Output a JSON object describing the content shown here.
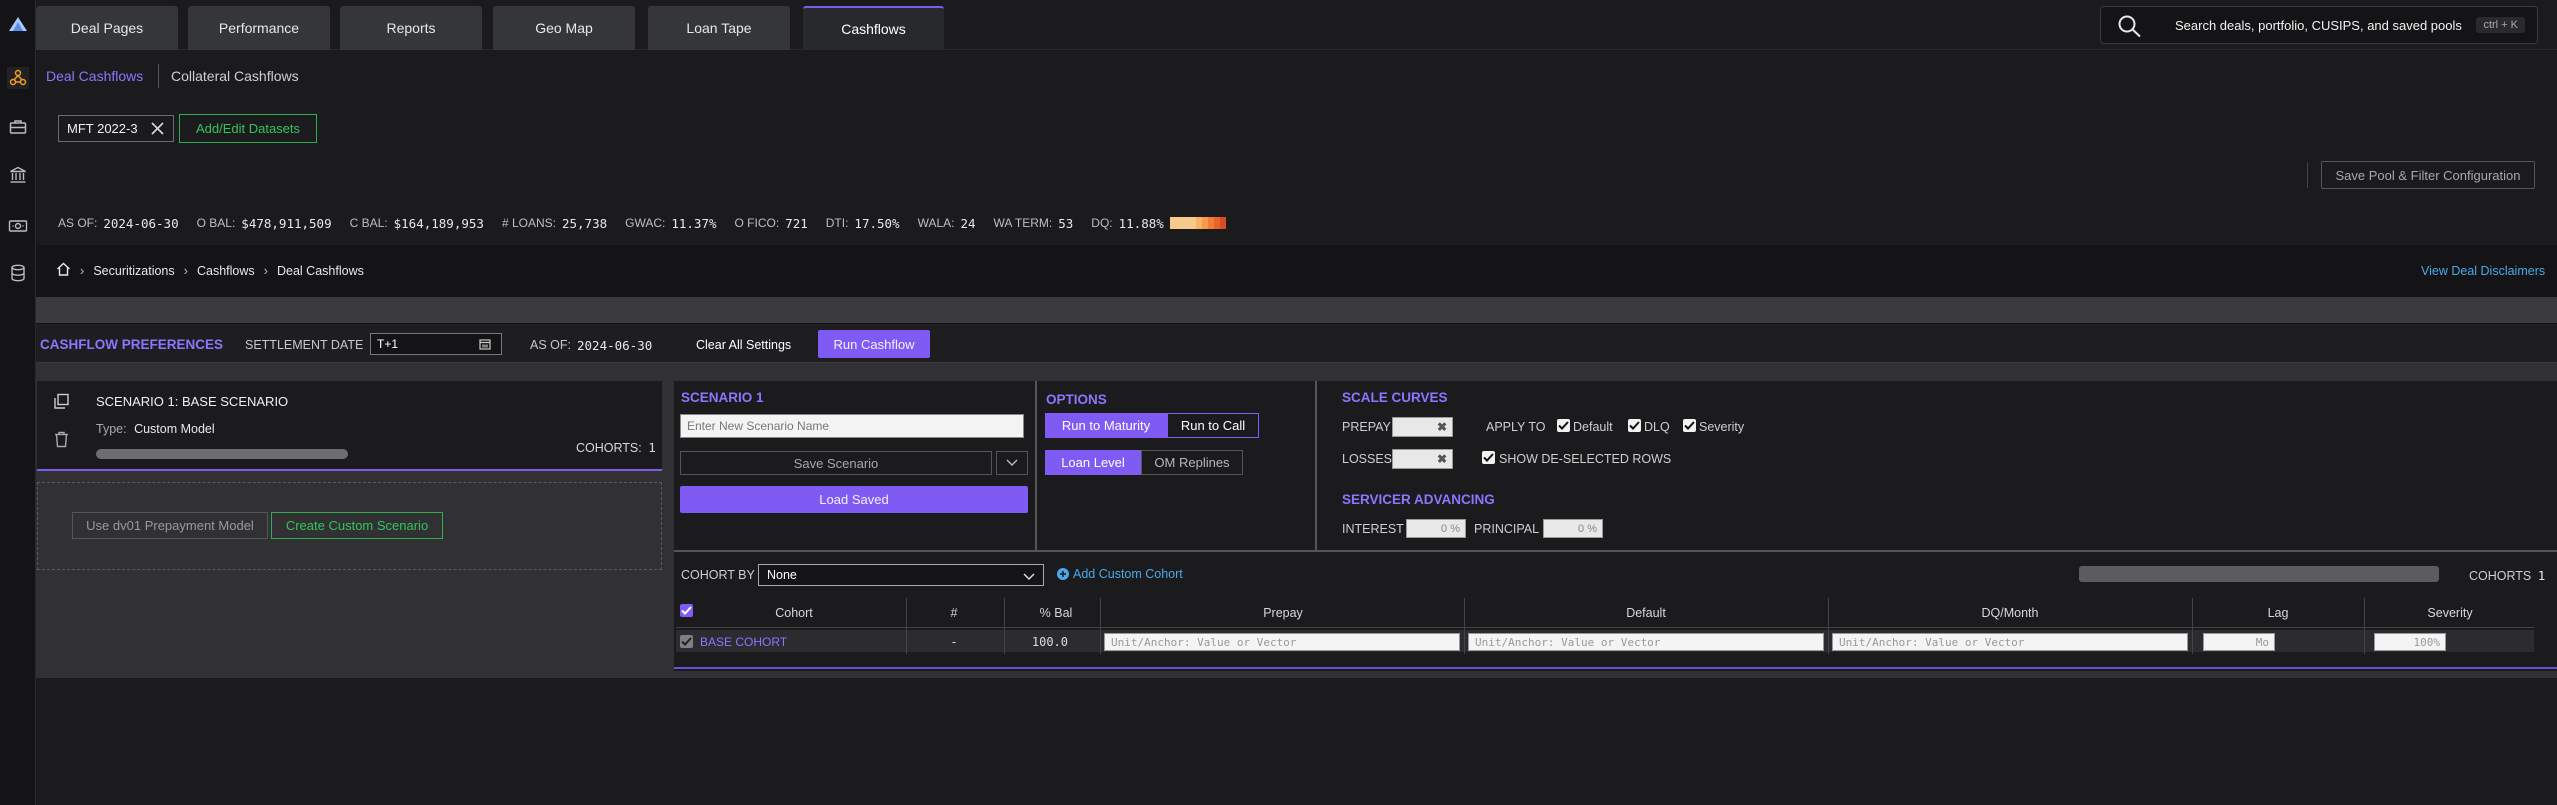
{
  "nav": {
    "tabs": [
      "Deal Pages",
      "Performance",
      "Reports",
      "Geo Map",
      "Loan Tape",
      "Cashflows"
    ],
    "active_tab": "Cashflows",
    "search_placeholder": "Search deals, portfolio, CUSIPS, and saved pools",
    "search_shortcut": "ctrl + K"
  },
  "rail_icons": [
    "logo-icon",
    "network-icon",
    "briefcase-icon",
    "bank-icon",
    "money-icon",
    "database-icon"
  ],
  "subtabs": {
    "deal_cashflows": "Deal Cashflows",
    "collateral_cashflows": "Collateral Cashflows"
  },
  "datasets": {
    "chip_label": "MFT 2022-3",
    "add_edit_label": "Add/Edit Datasets"
  },
  "save_pool_label": "Save Pool & Filter Configuration",
  "stats": [
    {
      "label": "AS OF:",
      "value": "2024-06-30"
    },
    {
      "label": "O BAL:",
      "value": "$478,911,509"
    },
    {
      "label": "C BAL:",
      "value": "$164,189,953"
    },
    {
      "label": "# LOANS:",
      "value": "25,738"
    },
    {
      "label": "GWAC:",
      "value": "11.37%"
    },
    {
      "label": "O FICO:",
      "value": "721"
    },
    {
      "label": "DTI:",
      "value": "17.50%"
    },
    {
      "label": "WALA:",
      "value": "24"
    },
    {
      "label": "WA TERM:",
      "value": "53"
    },
    {
      "label": "DQ:",
      "value": "11.88%"
    }
  ],
  "dq_bar_colors": [
    "#f7c98b",
    "#f7c98b",
    "#f7b26a",
    "#f59a4c",
    "#f07e33",
    "#e8642a",
    "#d94c22"
  ],
  "breadcrumb": [
    "Securitizations",
    "Cashflows",
    "Deal Cashflows"
  ],
  "disclaimers_label": "View Deal Disclaimers",
  "prefs": {
    "title": "CASHFLOW PREFERENCES",
    "settlement_label": "SETTLEMENT DATE",
    "settlement_value": "T+1",
    "as_of_label": "AS OF:",
    "as_of_value": "2024-06-30",
    "clear_label": "Clear All Settings",
    "run_label": "Run Cashflow"
  },
  "scenario_card": {
    "title": "SCENARIO 1: BASE SCENARIO",
    "type_label": "Type:",
    "type_value": "Custom Model",
    "cohorts_label": "COHORTS:",
    "cohorts_value": "1"
  },
  "scenario_actions": {
    "use_dv01": "Use dv01 Prepayment Model",
    "create_custom": "Create Custom Scenario"
  },
  "scenario_panel": {
    "title": "SCENARIO 1",
    "name_placeholder": "Enter New Scenario Name",
    "save_label": "Save Scenario",
    "load_label": "Load Saved"
  },
  "options": {
    "title": "OPTIONS",
    "run_to_maturity": "Run to Maturity",
    "run_to_call": "Run to Call",
    "loan_level": "Loan Level",
    "om_replines": "OM Replines"
  },
  "scale_curves": {
    "title": "SCALE CURVES",
    "prepay_label": "PREPAY",
    "losses_label": "LOSSES",
    "apply_to_label": "APPLY TO",
    "default_label": "Default",
    "dlq_label": "DLQ",
    "severity_label": "Severity",
    "show_deselected_label": "SHOW DE-SELECTED ROWS"
  },
  "servicer": {
    "title": "SERVICER ADVANCING",
    "interest_label": "INTEREST",
    "interest_placeholder": "0 %",
    "principal_label": "PRINCIPAL",
    "principal_placeholder": "0 %"
  },
  "cohort": {
    "by_label": "COHORT BY",
    "by_value": "None",
    "add_label": "Add Custom Cohort",
    "count_label": "COHORTS",
    "count_value": "1",
    "columns": [
      "Cohort",
      "#",
      "% Bal",
      "Prepay",
      "Default",
      "DQ/Month",
      "Lag",
      "Severity"
    ],
    "row": {
      "name": "BASE COHORT",
      "count": "-",
      "pct_bal": "100.0",
      "vector_placeholder": "Unit/Anchor: Value or Vector",
      "lag_placeholder": "Mo",
      "severity_placeholder": "100%"
    }
  }
}
